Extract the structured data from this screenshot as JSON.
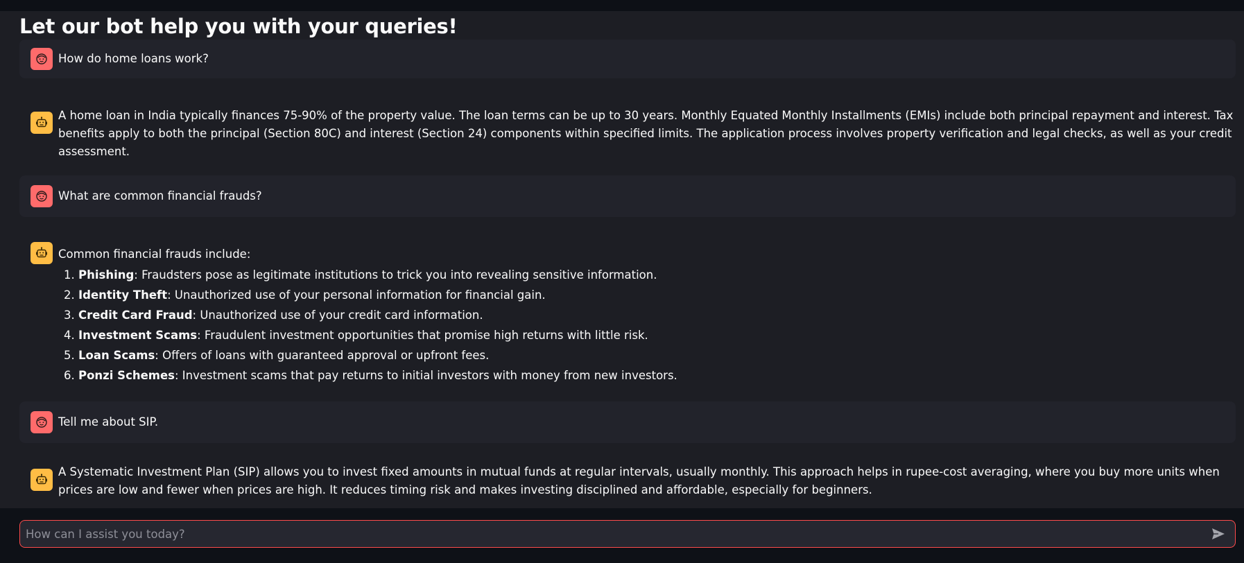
{
  "page": {
    "title": "Let our bot help you with your queries!"
  },
  "messages": [
    {
      "role": "user",
      "avatar_icon": "face-icon",
      "text": "How do home loans work?"
    },
    {
      "role": "assistant",
      "avatar_icon": "robot-icon",
      "text": "A home loan in India typically finances 75-90% of the property value. The loan terms can be up to 30 years. Monthly Equated Monthly Installments (EMIs) include both principal repayment and interest. Tax benefits apply to both the principal (Section 80C) and interest (Section 24) components within specified limits. The application process involves property verification and legal checks, as well as your credit assessment."
    },
    {
      "role": "user",
      "avatar_icon": "face-icon",
      "text": "What are common financial frauds?"
    },
    {
      "role": "assistant",
      "avatar_icon": "robot-icon",
      "intro": "Common financial frauds include:",
      "list": [
        {
          "term": "Phishing",
          "desc": ": Fraudsters pose as legitimate institutions to trick you into revealing sensitive information."
        },
        {
          "term": "Identity Theft",
          "desc": ": Unauthorized use of your personal information for financial gain."
        },
        {
          "term": "Credit Card Fraud",
          "desc": ": Unauthorized use of your credit card information."
        },
        {
          "term": "Investment Scams",
          "desc": ": Fraudulent investment opportunities that promise high returns with little risk."
        },
        {
          "term": "Loan Scams",
          "desc": ": Offers of loans with guaranteed approval or upfront fees."
        },
        {
          "term": "Ponzi Schemes",
          "desc": ": Investment scams that pay returns to initial investors with money from new investors."
        }
      ]
    },
    {
      "role": "user",
      "avatar_icon": "face-icon",
      "text": "Tell me about SIP."
    },
    {
      "role": "assistant",
      "avatar_icon": "robot-icon",
      "text": "A Systematic Investment Plan (SIP) allows you to invest fixed amounts in mutual funds at regular intervals, usually monthly. This approach helps in rupee-cost averaging, where you buy more units when prices are low and fewer when prices are high. It reduces timing risk and makes investing disciplined and affordable, especially for beginners."
    }
  ],
  "chat_input": {
    "placeholder": "How can I assist you today?",
    "value": "",
    "send_icon": "send-icon"
  },
  "colors": {
    "user_avatar": "#ff6b6b",
    "bot_avatar": "#ffbd45",
    "input_border": "#ff4b4b",
    "background": "#1d1e24"
  }
}
